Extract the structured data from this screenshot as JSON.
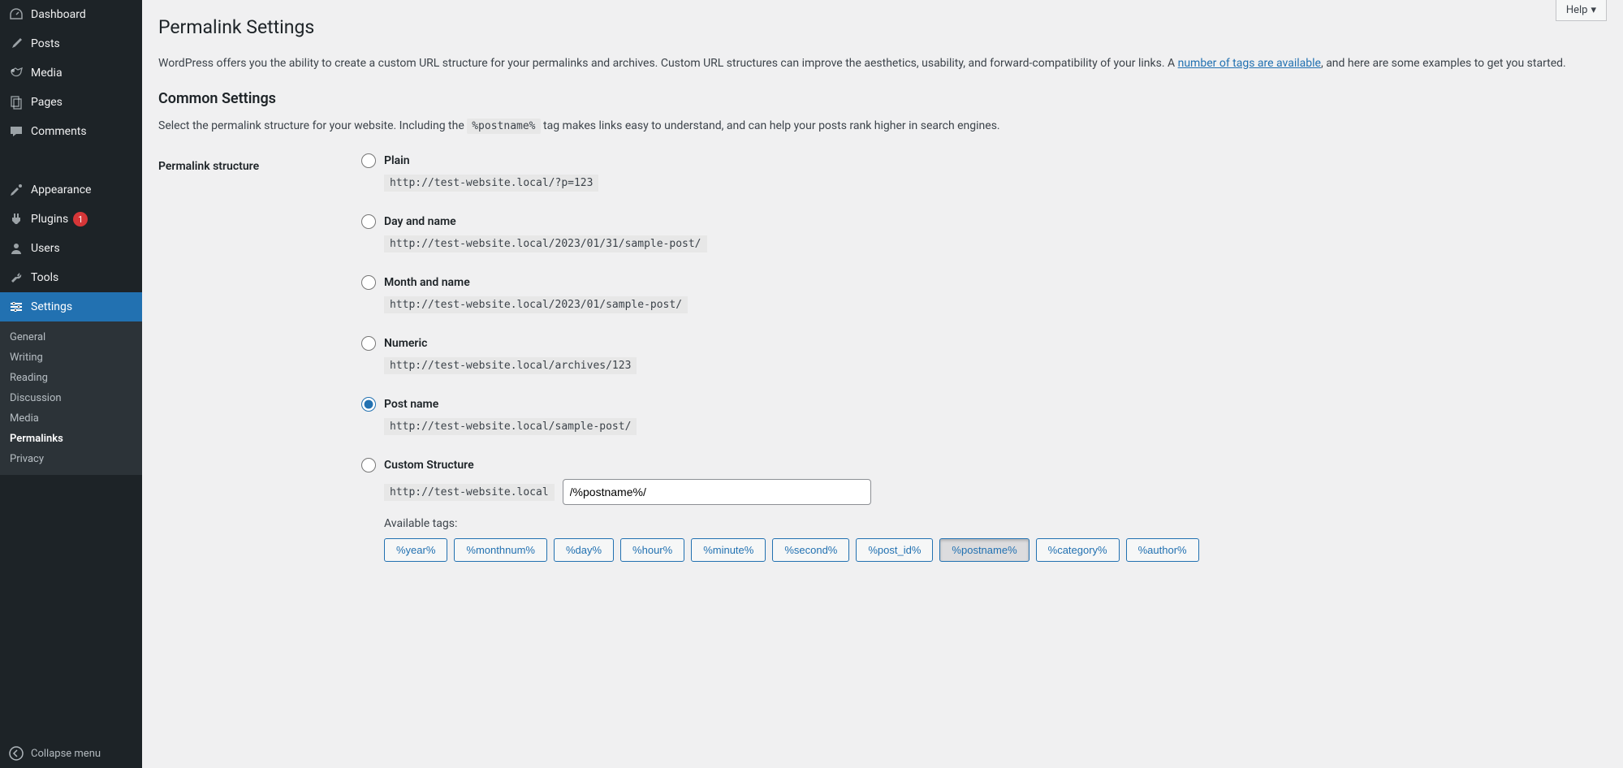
{
  "sidebar": {
    "items": [
      {
        "key": "dashboard",
        "label": "Dashboard"
      },
      {
        "key": "posts",
        "label": "Posts"
      },
      {
        "key": "media",
        "label": "Media"
      },
      {
        "key": "pages",
        "label": "Pages"
      },
      {
        "key": "comments",
        "label": "Comments"
      },
      {
        "key": "appearance",
        "label": "Appearance"
      },
      {
        "key": "plugins",
        "label": "Plugins",
        "badge": "1"
      },
      {
        "key": "users",
        "label": "Users"
      },
      {
        "key": "tools",
        "label": "Tools"
      },
      {
        "key": "settings",
        "label": "Settings",
        "current": true
      }
    ],
    "submenu": [
      {
        "key": "general",
        "label": "General"
      },
      {
        "key": "writing",
        "label": "Writing"
      },
      {
        "key": "reading",
        "label": "Reading"
      },
      {
        "key": "discussion",
        "label": "Discussion"
      },
      {
        "key": "media",
        "label": "Media"
      },
      {
        "key": "permalinks",
        "label": "Permalinks",
        "active": true
      },
      {
        "key": "privacy",
        "label": "Privacy"
      }
    ],
    "collapse_label": "Collapse menu"
  },
  "help_label": "Help",
  "page_title": "Permalink Settings",
  "intro_pre": "WordPress offers you the ability to create a custom URL structure for your permalinks and archives. Custom URL structures can improve the aesthetics, usability, and forward-compatibility of your links. A ",
  "intro_link": "number of tags are available",
  "intro_post": ", and here are some examples to get you started.",
  "common_heading": "Common Settings",
  "common_pre": "Select the permalink structure for your website. Including the ",
  "common_tag": "%postname%",
  "common_post": " tag makes links easy to understand, and can help your posts rank higher in search engines.",
  "structure_label": "Permalink structure",
  "options": [
    {
      "key": "plain",
      "label": "Plain",
      "example": "http://test-website.local/?p=123"
    },
    {
      "key": "day-name",
      "label": "Day and name",
      "example": "http://test-website.local/2023/01/31/sample-post/"
    },
    {
      "key": "month-name",
      "label": "Month and name",
      "example": "http://test-website.local/2023/01/sample-post/"
    },
    {
      "key": "numeric",
      "label": "Numeric",
      "example": "http://test-website.local/archives/123"
    },
    {
      "key": "post-name",
      "label": "Post name",
      "example": "http://test-website.local/sample-post/",
      "checked": true
    },
    {
      "key": "custom",
      "label": "Custom Structure"
    }
  ],
  "custom_base": "http://test-website.local",
  "custom_value": "/%postname%/",
  "available_label": "Available tags:",
  "tags": [
    "%year%",
    "%monthnum%",
    "%day%",
    "%hour%",
    "%minute%",
    "%second%",
    "%post_id%",
    "%postname%",
    "%category%",
    "%author%"
  ],
  "tag_pressed": "%postname%"
}
